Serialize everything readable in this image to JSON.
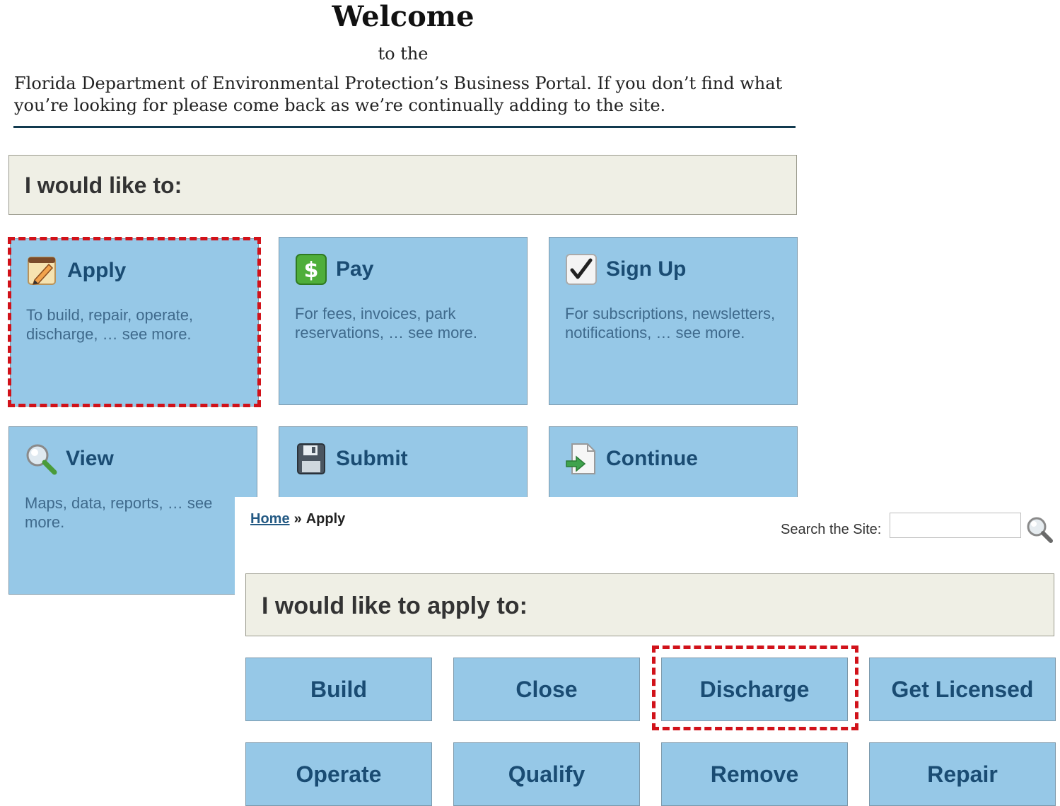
{
  "welcome": {
    "title": "Welcome",
    "subtitle": "to the",
    "intro": "Florida Department of Environmental Protection’s Business Portal. If you don’t find what you’re looking for please come back as we’re continually adding to the site."
  },
  "home_prompt": "I would like to:",
  "home_tiles": [
    {
      "title": "Apply",
      "desc": "To build, repair, operate, discharge, … see more.",
      "icon": "pencil-notepad-icon"
    },
    {
      "title": "Pay",
      "desc": "For fees, invoices, park reservations, … see more.",
      "icon": "dollar-icon"
    },
    {
      "title": "Sign Up",
      "desc": "For subscriptions, newsletters, notifications, … see more.",
      "icon": "checkmark-icon"
    },
    {
      "title": "View",
      "desc": "Maps, data, reports, … see more.",
      "icon": "magnifier-icon"
    },
    {
      "title": "Submit",
      "desc": "",
      "icon": "floppy-disk-icon"
    },
    {
      "title": "Continue",
      "desc": "",
      "icon": "document-arrow-icon"
    }
  ],
  "apply_page": {
    "breadcrumb": {
      "home": "Home",
      "separator": "»",
      "current": "Apply"
    },
    "search_label": "Search the Site:",
    "search_value": "",
    "prompt": "I would like to apply to:",
    "options": [
      "Build",
      "Close",
      "Discharge",
      "Get Licensed",
      "Operate",
      "Qualify",
      "Remove",
      "Repair"
    ]
  },
  "colors": {
    "tile_bg": "#96c8e7",
    "tile_text": "#1a4c73",
    "highlight": "#d1121a",
    "prompt_bg": "#efefe5"
  }
}
